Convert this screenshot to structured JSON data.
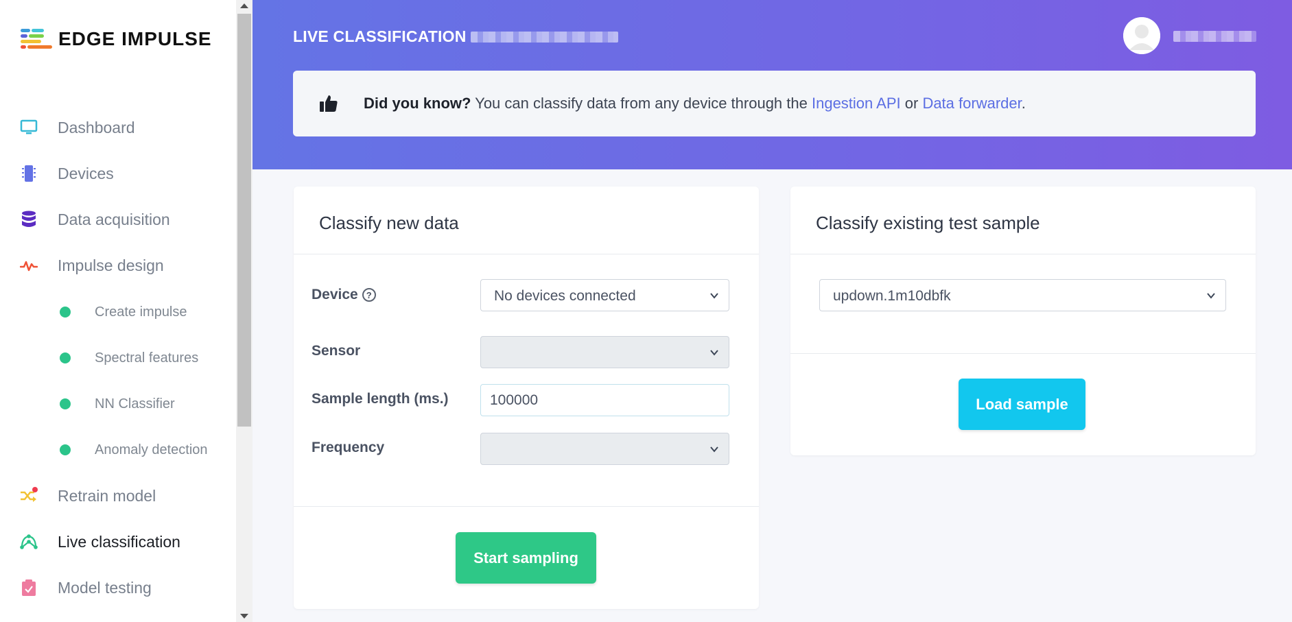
{
  "sidebar": {
    "logo_text": "EDGE IMPULSE",
    "items": [
      {
        "label": "Dashboard",
        "icon": "monitor-icon",
        "color": "#36b9d6"
      },
      {
        "label": "Devices",
        "icon": "chip-icon",
        "color": "#6372e5"
      },
      {
        "label": "Data acquisition",
        "icon": "database-icon",
        "color": "#5b2cc2"
      },
      {
        "label": "Impulse design",
        "icon": "pulse-icon",
        "color": "#ef5236"
      },
      {
        "label": "Retrain model",
        "icon": "shuffle-icon",
        "color": "#f2c233"
      },
      {
        "label": "Live classification",
        "icon": "network-icon",
        "color": "#2bc48a"
      },
      {
        "label": "Model testing",
        "icon": "clipboard-check-icon",
        "color": "#ee7b9f"
      }
    ],
    "sub_items": [
      {
        "label": "Create impulse"
      },
      {
        "label": "Spectral features"
      },
      {
        "label": "NN Classifier"
      },
      {
        "label": "Anomaly detection"
      }
    ],
    "active": "Live classification"
  },
  "header": {
    "title": "LIVE CLASSIFICATION",
    "tip": {
      "strong": "Did you know?",
      "text": " You can classify data from any device through the ",
      "link1": "Ingestion API",
      "middle": " or ",
      "link2": "Data forwarder",
      "end": "."
    }
  },
  "classify_new": {
    "title": "Classify new data",
    "device_label": "Device",
    "device_value": "No devices connected",
    "sensor_label": "Sensor",
    "sensor_value": "",
    "sample_length_label": "Sample length (ms.)",
    "sample_length_value": "100000",
    "frequency_label": "Frequency",
    "frequency_value": "",
    "start_button": "Start sampling"
  },
  "classify_existing": {
    "title": "Classify existing test sample",
    "sample_value": "updown.1m10dbfk",
    "load_button": "Load sample"
  },
  "colors": {
    "accent_green": "#2ec887",
    "accent_cyan": "#12c7ee",
    "header_start": "#6474e5",
    "header_end": "#7e5ce2",
    "link": "#5b6ee3"
  }
}
